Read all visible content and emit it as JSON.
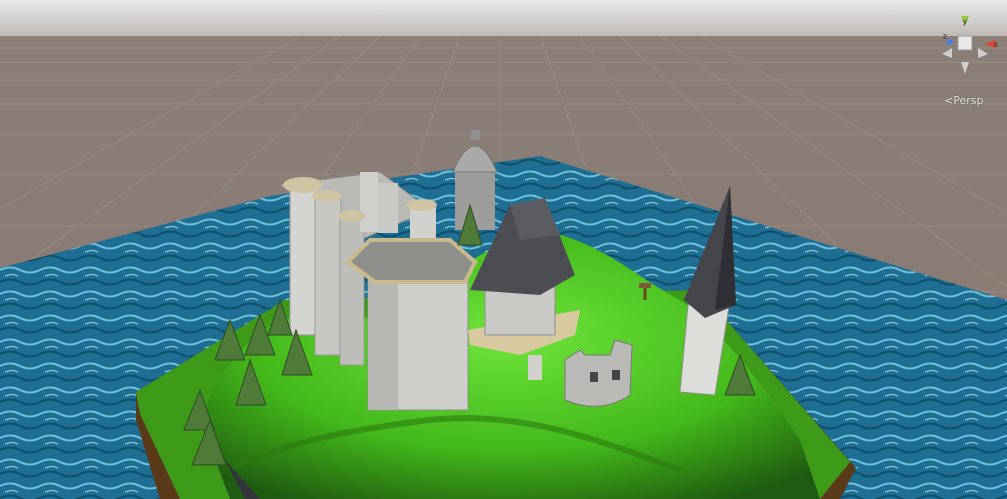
{
  "view": {
    "projection_label": "Persp",
    "gizmo_axes": {
      "x": "x",
      "y": "y",
      "z": "z"
    }
  },
  "colors": {
    "sky": "#c7c9c8",
    "ground": "#8b7d74",
    "grid": "#9a8c83",
    "water": "#1f6e93",
    "grass": "#4dc21e",
    "stone": "#c8c8c4",
    "roof": "#4a4c52",
    "trim": "#c9b98c",
    "gizmo_x": "#e0432f",
    "gizmo_y": "#92c83a",
    "gizmo_z": "#4a7ee0"
  },
  "objects": [
    "water-plane",
    "island-terrain",
    "castle-wall-towers",
    "main-keep-tower",
    "domed-tower",
    "chapel-roof-building",
    "ruined-tower",
    "spire-tower",
    "pine-trees",
    "signpost"
  ]
}
